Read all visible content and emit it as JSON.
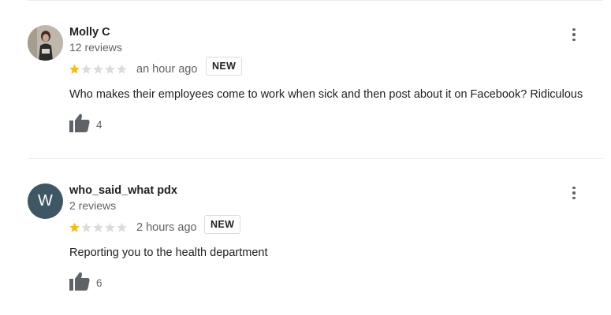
{
  "reviews": [
    {
      "author": "Molly C",
      "review_count": "12 reviews",
      "avatar": {
        "type": "photo",
        "letter": ""
      },
      "rating": 1,
      "max_rating": 5,
      "time": "an hour ago",
      "badge": "NEW",
      "text": "Who makes their employees come to work when sick and then post about it on Facebook? Ridiculous",
      "likes": "4",
      "icons": {
        "menu": "more-vert-icon",
        "like": "thumbs-up-icon"
      }
    },
    {
      "author": "who_said_what pdx",
      "review_count": "2 reviews",
      "avatar": {
        "type": "letter",
        "letter": "W",
        "color": "#3f5665"
      },
      "rating": 1,
      "max_rating": 5,
      "time": "2 hours ago",
      "badge": "NEW",
      "text": "Reporting you to the health department",
      "likes": "6",
      "icons": {
        "menu": "more-vert-icon",
        "like": "thumbs-up-icon"
      }
    }
  ],
  "colors": {
    "star_filled": "#fbbc04",
    "star_empty": "#dadce0",
    "text_secondary": "#5f6368"
  }
}
